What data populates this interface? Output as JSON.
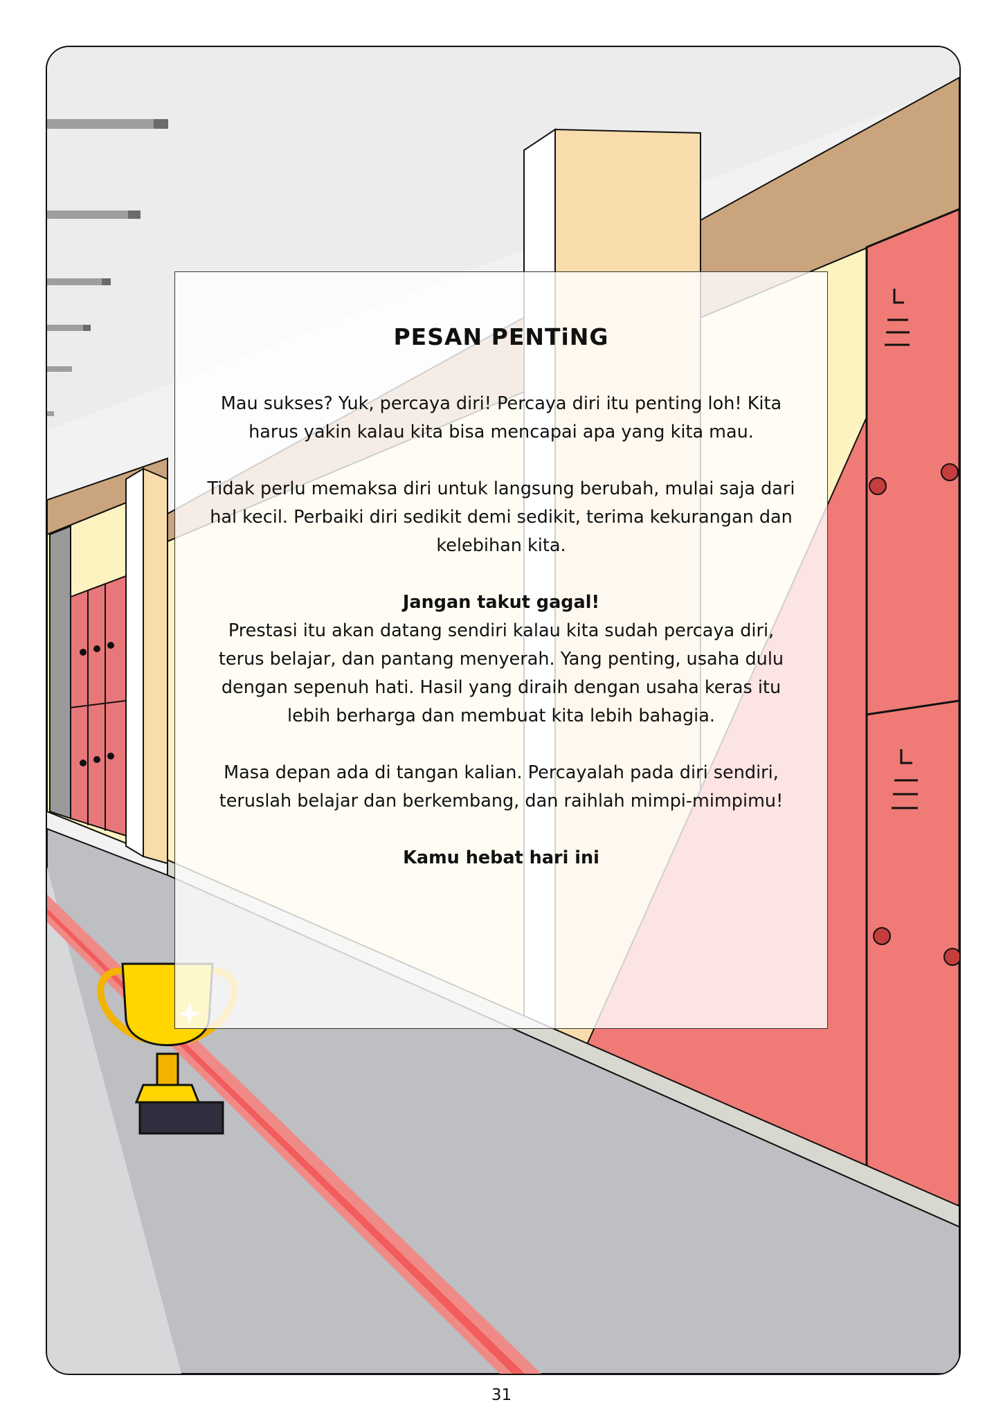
{
  "page": {
    "title": "PESAN PENTiNG",
    "paragraph1": "Mau sukses? Yuk, percaya diri! Percaya diri itu penting loh! Kita harus yakin kalau kita bisa mencapai apa yang kita mau.",
    "paragraph2": "Tidak perlu memaksa diri untuk langsung berubah, mulai saja dari hal kecil. Perbaiki diri sedikit demi sedikit, terima kekurangan dan kelebihan kita.",
    "paragraph3_heading": "Jangan takut gagal!",
    "paragraph3": "Prestasi itu akan datang sendiri kalau kita sudah percaya diri, terus belajar, dan pantang menyerah. Yang penting, usaha dulu dengan sepenuh hati. Hasil yang diraih dengan usaha keras itu lebih berharga dan membuat kita lebih bahagia.",
    "paragraph4": "Masa depan ada di tangan kalian. Percayalah pada diri sendiri, teruslah belajar dan berkembang, dan raihlah mimpi-mimpimu!",
    "closing": "Kamu hebat hari ini",
    "page_number": "31"
  },
  "colors": {
    "locker_red": "#f07a75",
    "wall_yellow": "#fdf3c0",
    "wall_beam": "#caa47c",
    "floor_gray": "#bdbfc2",
    "red_stripe": "#f07a75",
    "trophy_gold": "#ffd600"
  }
}
